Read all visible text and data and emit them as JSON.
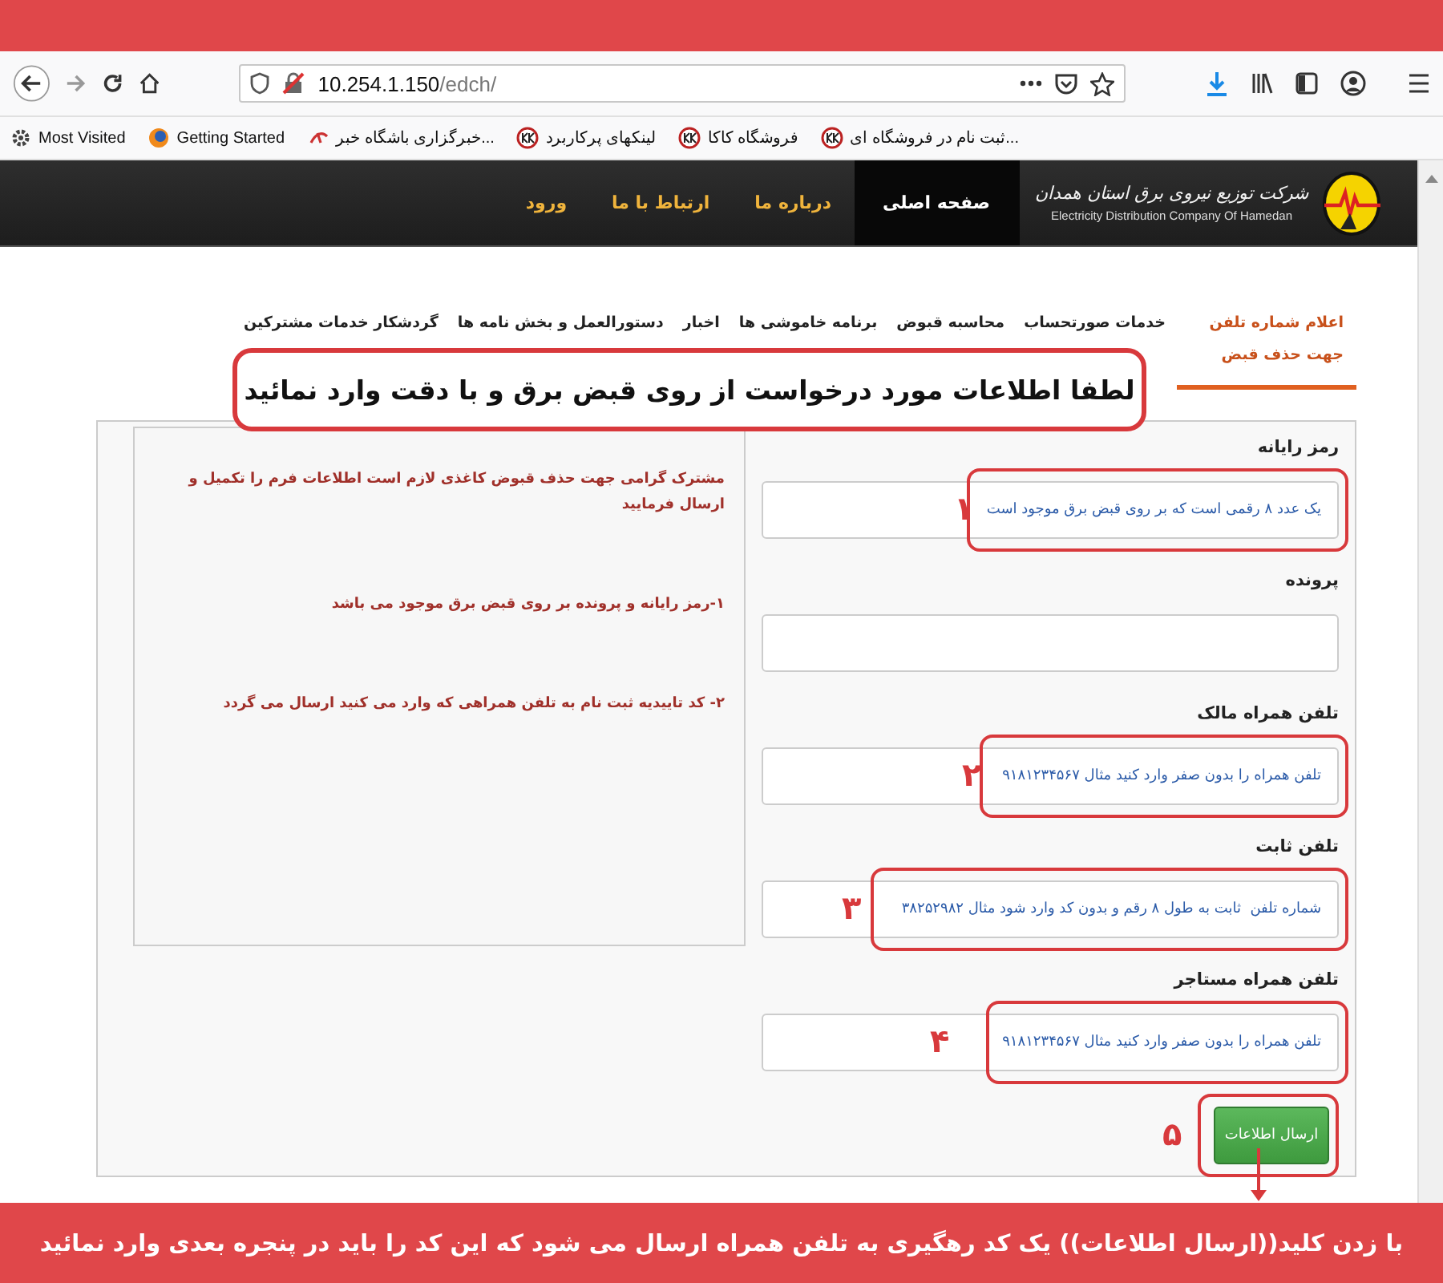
{
  "browser": {
    "url_host": "10.254.1.150",
    "url_path": "/edch/",
    "bookmarks": [
      {
        "label": "ثبت نام در فروشگاه ای...",
        "kind": "kk"
      },
      {
        "label": "فروشگاه کاکا",
        "kind": "kk"
      },
      {
        "label": "لینکهای پرکاربرد",
        "kind": "kk"
      },
      {
        "label": "خبرگزاری باشگاه خبر...",
        "kind": "mark"
      },
      {
        "label": "Getting Started",
        "kind": "globe"
      },
      {
        "label": "Most Visited",
        "kind": "gear"
      }
    ]
  },
  "site_header": {
    "logo_text": "شرکت توزیع نیروی برق استان همدان",
    "logo_subtitle": "Electricity Distribution Company Of Hamedan",
    "nav": [
      {
        "label": "صفحه اصلی",
        "selected": true
      },
      {
        "label": "درباره ما",
        "selected": false
      },
      {
        "label": "ارتباط با ما",
        "selected": false
      },
      {
        "label": "ورود",
        "selected": false
      }
    ]
  },
  "tabs": [
    {
      "label": "اعلام شماره تلفن جهت حذف قبض",
      "selected": true
    },
    {
      "label": "خدمات صورتحساب",
      "selected": false
    },
    {
      "label": "محاسبه قبوض",
      "selected": false
    },
    {
      "label": "برنامه خاموشی ها",
      "selected": false
    },
    {
      "label": "اخبار",
      "selected": false
    },
    {
      "label": "دستورالعمل و بخش نامه ها",
      "selected": false
    },
    {
      "label": "گردشکار خدمات مشترکین",
      "selected": false
    }
  ],
  "annotation_banner": "لطفا اطلاعات مورد درخواست از روی قبض برق و با دقت وارد نمائید",
  "info_panel": {
    "paragraphs": [
      "مشترک گرامی جهت حذف قبوض کاغذی لازم است اطلاعات فرم را تکمیل و ارسال فرمایید",
      "۱-رمز رایانه و پرونده بر روی قبض برق موجود می باشد",
      "۲- کد تاییدیه ثبت نام به تلفن همراهی که وارد می کنید ارسال می گردد"
    ]
  },
  "form": {
    "fields": [
      {
        "label": "رمز رایانه",
        "placeholder": "یک عدد ۸ رقمی است که بر روی قبض برق موجود است",
        "annotation": "۱"
      },
      {
        "label": "پرونده"
      },
      {
        "label": "تلفن همراه مالک",
        "placeholder": "تلفن همراه را بدون صفر وارد کنید مثال ۹۱۸۱۲۳۴۵۶۷",
        "annotation": "۲"
      },
      {
        "label": "تلفن ثابت",
        "placeholder": "شماره تلفن  ثابت به طول ۸ رقم و بدون کد وارد شود مثال ۳۸۲۵۲۹۸۲",
        "annotation": "۳"
      },
      {
        "label": "تلفن همراه مستاجر",
        "placeholder": "تلفن همراه را بدون صفر وارد کنید مثال ۹۱۸۱۲۳۴۵۶۷",
        "annotation": "۴"
      }
    ],
    "submit": {
      "label": "ارسال اطلاعات",
      "annotation": "۵"
    }
  },
  "footer_note": "با زدن کلید((ارسال اطلاعات)) یک کد رهگیری به تلفن همراه ارسال می شود که این کد را باید در پنجره بعدی وارد نمائید"
}
